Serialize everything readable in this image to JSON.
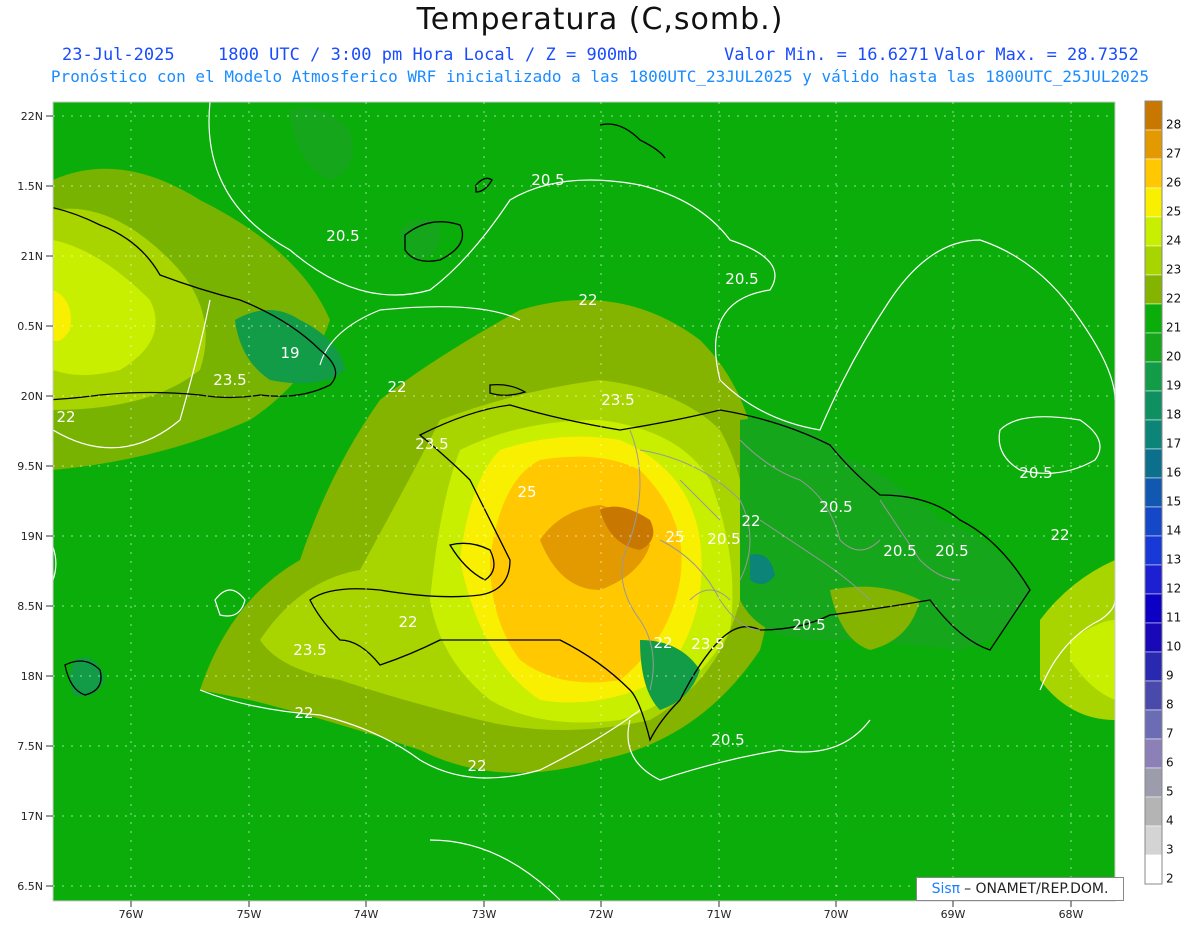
{
  "title": "Temperatura (C,somb.)",
  "header": {
    "date": "23-Jul-2025",
    "time": "1800 UTC / 3:00 pm Hora Local / Z = 900mb",
    "min": "Valor Min. = 16.6271",
    "max": "Valor Max. = 28.7352",
    "subtitle": "Pronóstico con el Modelo Atmosferico WRF inicializado a las 1800UTC_23JUL2025 y válido hasta las  1800UTC_25JUL2025"
  },
  "axes": {
    "lat_labels": [
      "22N",
      "1.5N",
      "21N",
      "0.5N",
      "20N",
      "9.5N",
      "19N",
      "8.5N",
      "18N",
      "7.5N",
      "17N",
      "6.5N"
    ],
    "lon_labels": [
      "76W",
      "75W",
      "74W",
      "73W",
      "72W",
      "71W",
      "70W",
      "69W",
      "68W"
    ]
  },
  "contour_labels": [
    "20.5",
    "20.5",
    "20.5",
    "20.5",
    "20.5",
    "20.5",
    "20.5",
    "20.5",
    "20.5",
    "20.5",
    "22",
    "22",
    "22",
    "22",
    "22",
    "22",
    "22",
    "22",
    "22",
    "23.5",
    "23.5",
    "23.5",
    "23.5",
    "23.5",
    "25",
    "25",
    "19"
  ],
  "colorbar": {
    "labels": [
      "28",
      "27",
      "26",
      "25",
      "24",
      "23",
      "22",
      "21",
      "20",
      "19",
      "18",
      "17",
      "16",
      "15",
      "14",
      "13",
      "12",
      "11",
      "10",
      "9",
      "8",
      "7",
      "6",
      "5",
      "4",
      "3",
      "2"
    ],
    "colors": [
      "#c87800",
      "#e39a00",
      "#ffc800",
      "#f8f000",
      "#c8ee00",
      "#a8d400",
      "#84b400",
      "#0aad0a",
      "#16a61c",
      "#129c48",
      "#0e9062",
      "#0c8478",
      "#0c708c",
      "#1058b0",
      "#1448c8",
      "#1838d8",
      "#1c20d2",
      "#0c00c4",
      "#1808b8",
      "#2828b0",
      "#4a4aac",
      "#6c6cb4",
      "#8c80b8",
      "#9c9cac",
      "#b4b4b4",
      "#d4d4d4",
      "#ffffff"
    ]
  },
  "colors": {
    "ocean": "#0aad0a",
    "contour": "#ffffff",
    "border": "#999999",
    "coast": "#000000"
  },
  "credit": {
    "logo": "Sisπ",
    "text": "– ONAMET/REP.DOM."
  }
}
